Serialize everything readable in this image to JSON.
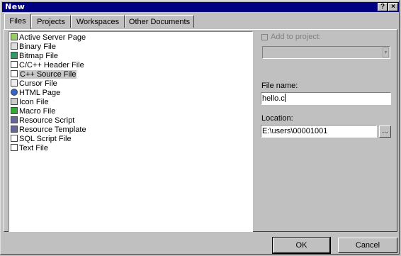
{
  "window": {
    "title": "New",
    "help_btn": "?",
    "close_btn": "×"
  },
  "tabs": [
    {
      "label": "Files"
    },
    {
      "label": "Projects"
    },
    {
      "label": "Workspaces"
    },
    {
      "label": "Other Documents"
    }
  ],
  "file_types": [
    {
      "label": "Active Server Page",
      "icon": "asp-icon"
    },
    {
      "label": "Binary File",
      "icon": "binary-icon"
    },
    {
      "label": "Bitmap File",
      "icon": "bitmap-icon"
    },
    {
      "label": "C/C++ Header File",
      "icon": "header-icon"
    },
    {
      "label": "C++ Source File",
      "icon": "source-icon"
    },
    {
      "label": "Cursor File",
      "icon": "cursor-icon"
    },
    {
      "label": "HTML Page",
      "icon": "html-icon"
    },
    {
      "label": "Icon File",
      "icon": "icon-file-icon"
    },
    {
      "label": "Macro File",
      "icon": "macro-icon"
    },
    {
      "label": "Resource Script",
      "icon": "resource-script-icon"
    },
    {
      "label": "Resource Template",
      "icon": "resource-template-icon"
    },
    {
      "label": "SQL Script File",
      "icon": "sql-icon"
    },
    {
      "label": "Text File",
      "icon": "text-icon"
    }
  ],
  "selected_file_type": "C++ Source File",
  "add_to_project": {
    "label": "Add to project:",
    "checked": false,
    "enabled": false
  },
  "file_name": {
    "label": "File name:",
    "value": "hello.c"
  },
  "location": {
    "label": "Location:",
    "value": "E:\\users\\00001001",
    "browse": "..."
  },
  "buttons": {
    "ok": "OK",
    "cancel": "Cancel"
  }
}
